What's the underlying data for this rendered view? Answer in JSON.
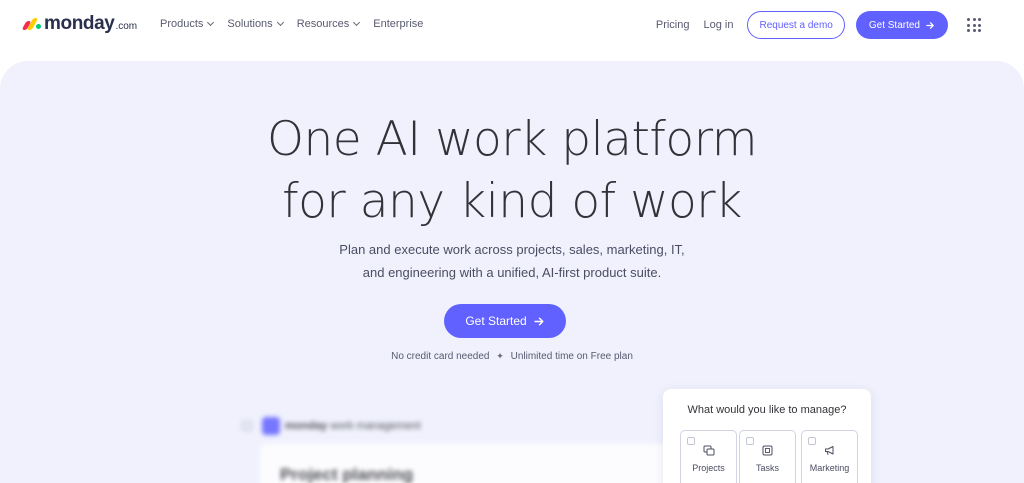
{
  "nav": {
    "logo": {
      "word": "monday",
      "suffix": ".com"
    },
    "menu": [
      {
        "label": "Products",
        "has_dropdown": true
      },
      {
        "label": "Solutions",
        "has_dropdown": true
      },
      {
        "label": "Resources",
        "has_dropdown": true
      },
      {
        "label": "Enterprise",
        "has_dropdown": false
      }
    ],
    "pricing": "Pricing",
    "login": "Log in",
    "demo_button": "Request a demo",
    "start_button": "Get Started",
    "apps_icon": "grid-dots-icon"
  },
  "hero": {
    "title_line1": "One AI work platform",
    "title_line2": "for any kind of work",
    "subtitle_line1": "Plan and execute work across projects, sales, marketing, IT,",
    "subtitle_line2": "and engineering with a unified, AI-first product suite.",
    "cta": "Get Started",
    "note_left": "No credit card needed",
    "note_right": "Unlimited time on Free plan"
  },
  "preview": {
    "brand": "monday",
    "product": "work management",
    "board_title": "Project planning"
  },
  "manage": {
    "question": "What would you like to manage?",
    "options": [
      {
        "label": "Projects",
        "icon": "projects-icon"
      },
      {
        "label": "Tasks",
        "icon": "tasks-icon"
      },
      {
        "label": "Marketing",
        "icon": "megaphone-icon"
      }
    ]
  },
  "colors": {
    "accent": "#6161ff",
    "hero_bg": "#f0f1fd",
    "text": "#323338"
  }
}
